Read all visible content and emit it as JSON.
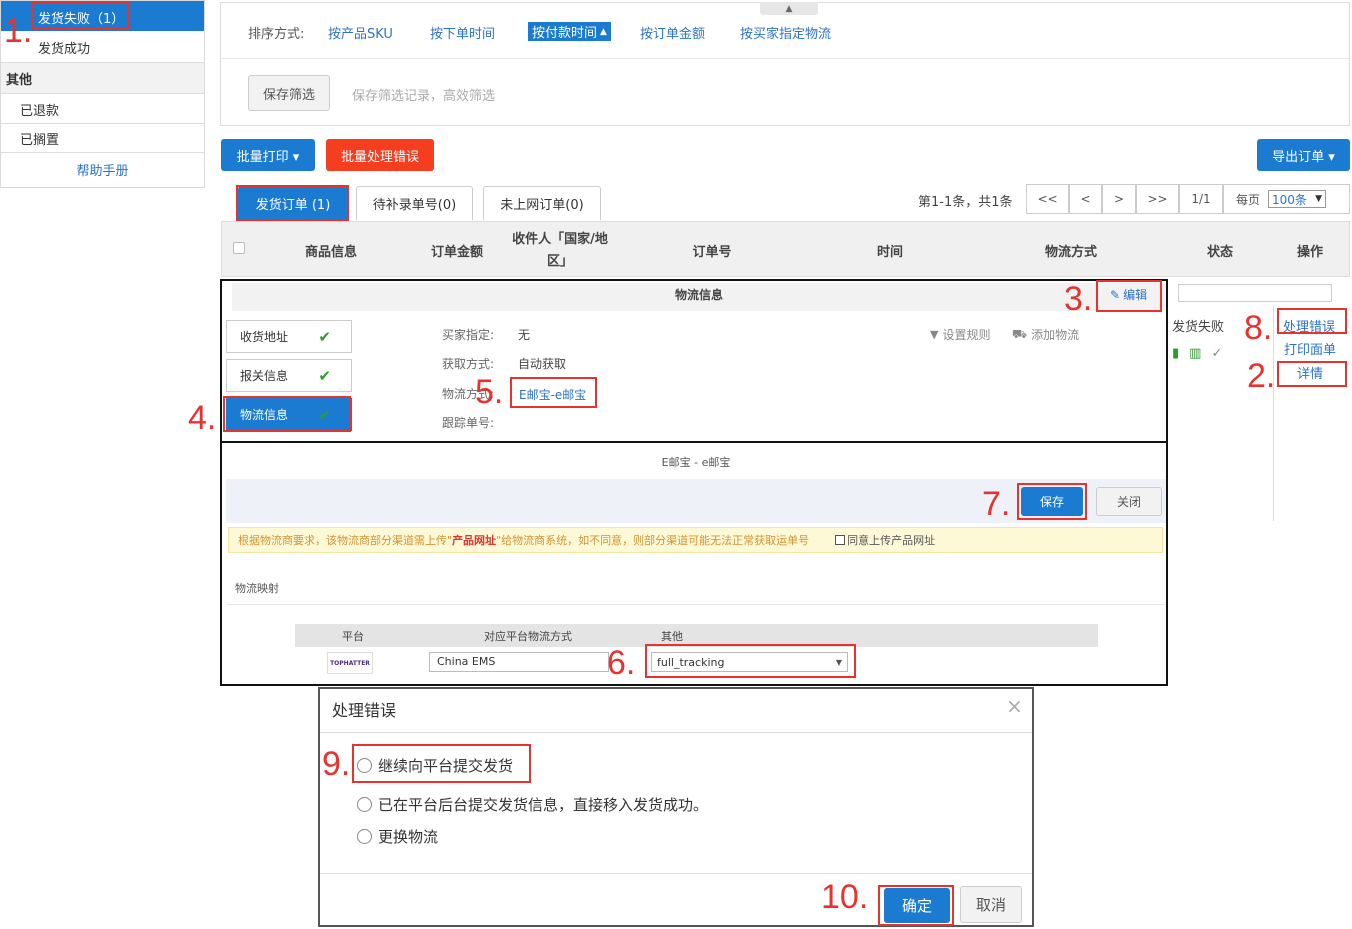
{
  "sidebar": {
    "failed_label": "发货失败",
    "failed_count": "（1）",
    "success_label": "发货成功",
    "other_header": "其他",
    "refunded": "已退款",
    "on_hold": "已搁置",
    "help": "帮助手册"
  },
  "sort": {
    "label": "排序方式:",
    "options": [
      "按产品SKU",
      "按下单时间",
      "按付款时间",
      "按订单金额",
      "按买家指定物流"
    ],
    "active_arrow": "▲"
  },
  "filter": {
    "save_button": "保存筛选",
    "hint": "保存筛选记录，高效筛选"
  },
  "toolbar": {
    "batch_print": "批量打印 ▾",
    "batch_fix": "批量处理错误",
    "export": "导出订单 ▾"
  },
  "tabs": [
    "发货订单 (1)",
    "待补录单号(0)",
    "未上网订单(0)"
  ],
  "pager": {
    "summary": "第1-1条，共1条",
    "first": "<<",
    "prev": "<",
    "next": ">",
    "last": ">>",
    "page": "1/1",
    "per_page_label": "每页",
    "per_page_value": "100条",
    "per_page_arrow": "▼"
  },
  "table_headers": [
    "商品信息",
    "订单金额",
    "收件人「国家/地区」",
    "订单号",
    "时间",
    "物流方式",
    "状态",
    "操作"
  ],
  "logistics": {
    "title": "物流信息",
    "edit": "编辑",
    "side_tabs": [
      "收货地址",
      "报关信息",
      "物流信息"
    ],
    "check": "✔",
    "buyer_label": "买家指定:",
    "buyer_value": "无",
    "fetch_label": "获取方式:",
    "fetch_value": "自动获取",
    "method_label": "物流方式:",
    "method_value": "E邮宝-e邮宝",
    "tracking_label": "跟踪单号:",
    "set_rule": "设置规则",
    "add_logistics": "添加物流"
  },
  "order_row": {
    "status": "发货失败",
    "fix_error": "处理错误",
    "print_label": "打印面单",
    "details": "详情"
  },
  "carrier_panel": {
    "title": "E邮宝 - e邮宝",
    "save": "保存",
    "close": "关闭",
    "warning_a": "根据物流商要求，该物流商部分渠道需上传\"",
    "warning_b": "产品网址",
    "warning_c": "\"给物流商系统，如不同意，则部分渠道可能无法正常获取运单号",
    "agree": "同意上传产品网址",
    "mapping_title": "物流映射",
    "col_platform": "平台",
    "col_method": "对应平台物流方式",
    "col_other": "其他",
    "platform_logo": "TOPHATTER",
    "method_value": "China EMS",
    "other_value": "full_tracking"
  },
  "dialog": {
    "title": "处理错误",
    "close": "×",
    "options": [
      "继续向平台提交发货",
      "已在平台后台提交发货信息，直接移入发货成功。",
      "更换物流"
    ],
    "confirm": "确定",
    "cancel": "取消"
  },
  "steps": [
    "1.",
    "2.",
    "3.",
    "4.",
    "5.",
    "6.",
    "7.",
    "8.",
    "9.",
    "10."
  ],
  "colors": {
    "primary": "#1b7bd1",
    "danger": "#f53d1f",
    "annotation": "#e8322d",
    "link": "#2b73c8",
    "success": "#2e9a2e"
  }
}
